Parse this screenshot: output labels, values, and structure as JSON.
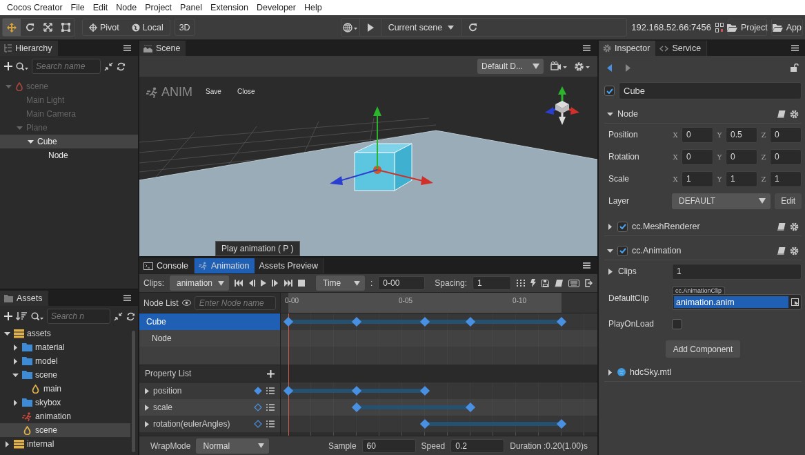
{
  "menu": [
    "Cocos Creator",
    "File",
    "Edit",
    "Node",
    "Project",
    "Panel",
    "Extension",
    "Developer",
    "Help"
  ],
  "toolbar": {
    "tools": [
      {
        "kind": "move",
        "selected": true
      },
      {
        "kind": "rotate",
        "selected": false
      },
      {
        "kind": "scale",
        "selected": false
      },
      {
        "kind": "rect",
        "selected": false
      }
    ],
    "pivot": "Pivot",
    "local": "Local",
    "view_mode": "3D",
    "scene": "Current scene",
    "address": "192.168.52.66:7456",
    "project": "Project",
    "app": "App"
  },
  "hierarchy": {
    "title": "Hierarchy",
    "search_placeholder": "Search name",
    "tree": [
      {
        "name": "scene",
        "kind": "scene",
        "disabled": true,
        "expanded": true,
        "selected": false,
        "children": [
          {
            "name": "Main Light",
            "disabled": true,
            "selected": false
          },
          {
            "name": "Main Camera",
            "disabled": true,
            "selected": false
          },
          {
            "name": "Plane",
            "disabled": true,
            "expanded": true,
            "selected": false,
            "children": [
              {
                "name": "Cube",
                "disabled": false,
                "expanded": true,
                "selected": true,
                "children": [
                  {
                    "name": "Node",
                    "disabled": false,
                    "selected": false
                  }
                ]
              }
            ]
          }
        ]
      }
    ]
  },
  "assets": {
    "title": "Assets",
    "search_placeholder": "Search n",
    "tree": [
      {
        "name": "assets",
        "kind": "database",
        "expanded": true,
        "selected": false,
        "children": [
          {
            "name": "material",
            "kind": "folder",
            "expanded": false,
            "selected": false
          },
          {
            "name": "model",
            "kind": "folder",
            "expanded": false,
            "selected": false
          },
          {
            "name": "scene",
            "kind": "folder",
            "expanded": true,
            "selected": false,
            "children": [
              {
                "name": "main",
                "kind": "scene",
                "selected": false
              }
            ]
          },
          {
            "name": "skybox",
            "kind": "folder",
            "expanded": false,
            "selected": false
          },
          {
            "name": "animation",
            "kind": "animation",
            "selected": false
          },
          {
            "name": "scene",
            "kind": "scene",
            "selected": true
          }
        ]
      },
      {
        "name": "internal",
        "kind": "database",
        "expanded": false,
        "selected": false
      }
    ]
  },
  "scene": {
    "title": "Scene",
    "layout": "Default D...",
    "overlay_title": "ANIM",
    "save": "Save",
    "close": "Close"
  },
  "animation": {
    "tabs": [
      {
        "label": "Console",
        "kind": "console",
        "selected": false
      },
      {
        "label": "Animation",
        "kind": "animation",
        "selected": true
      },
      {
        "label": "Assets Preview",
        "kind": "preview",
        "selected": false
      }
    ],
    "tooltip": "Play animation ( P )",
    "clips_label": "Clips:",
    "clip": "animation",
    "time_mode": "Time",
    "time_separator": ":",
    "time_value": "0-00",
    "spacing_label": "Spacing:",
    "spacing": "1",
    "node_list_label": "Node List",
    "node_search_placeholder": "Enter Node name",
    "ruler": [
      "0-00",
      "0-05",
      "0-10"
    ],
    "nodes": [
      {
        "name": "Cube",
        "selected": true,
        "frames": [
          {
            "keyed": true
          },
          {
            "keyed": false
          },
          {
            "keyed": false
          },
          {
            "keyed": true
          },
          {
            "keyed": false
          },
          {
            "keyed": false
          },
          {
            "keyed": true
          },
          {
            "keyed": false
          },
          {
            "keyed": true
          },
          {
            "keyed": false
          },
          {
            "keyed": false
          },
          {
            "keyed": false
          },
          {
            "keyed": true
          }
        ]
      },
      {
        "name": "Node",
        "selected": false
      }
    ],
    "property_list_label": "Property List",
    "properties": [
      {
        "name": "position",
        "keyed": true,
        "frames": [
          {
            "keyed": true
          },
          {
            "keyed": false
          },
          {
            "keyed": false
          },
          {
            "keyed": true
          },
          {
            "keyed": false
          },
          {
            "keyed": false
          },
          {
            "keyed": true
          }
        ]
      },
      {
        "name": "scale",
        "keyed": false,
        "frames": [
          {
            "keyed": false
          },
          {
            "keyed": false
          },
          {
            "keyed": false
          },
          {
            "keyed": true
          },
          {
            "keyed": false
          },
          {
            "keyed": false
          },
          {
            "keyed": false
          },
          {
            "keyed": false
          },
          {
            "keyed": true
          }
        ]
      },
      {
        "name": "rotation(eulerAngles)",
        "keyed": false,
        "frames": [
          {
            "keyed": false
          },
          {
            "keyed": false
          },
          {
            "keyed": false
          },
          {
            "keyed": false
          },
          {
            "keyed": false
          },
          {
            "keyed": false
          },
          {
            "keyed": true
          },
          {
            "keyed": false
          },
          {
            "keyed": false
          },
          {
            "keyed": false
          },
          {
            "keyed": false
          },
          {
            "keyed": false
          },
          {
            "keyed": true
          }
        ]
      }
    ],
    "wrap_mode_label": "WrapMode",
    "wrap_mode": "Normal",
    "sample_label": "Sample",
    "sample": "60",
    "speed_label": "Speed",
    "speed": "0.2",
    "duration": "Duration :0.20(1.00)s"
  },
  "inspector": {
    "tabs": [
      {
        "label": "Inspector",
        "kind": "gear",
        "selected": true
      },
      {
        "label": "Service",
        "kind": "link",
        "selected": false
      }
    ],
    "node_name": "Cube",
    "active": true,
    "node_section": {
      "title": "Node",
      "expanded": true,
      "vectors": [
        {
          "label": "Position",
          "values": [
            {
              "axis": "X",
              "value": "0"
            },
            {
              "axis": "Y",
              "value": "0.5"
            },
            {
              "axis": "Z",
              "value": "0"
            }
          ]
        },
        {
          "label": "Rotation",
          "values": [
            {
              "axis": "X",
              "value": "0"
            },
            {
              "axis": "Y",
              "value": "0"
            },
            {
              "axis": "Z",
              "value": "0"
            }
          ]
        },
        {
          "label": "Scale",
          "values": [
            {
              "axis": "X",
              "value": "1"
            },
            {
              "axis": "Y",
              "value": "1"
            },
            {
              "axis": "Z",
              "value": "1"
            }
          ]
        }
      ],
      "layer_label": "Layer",
      "layer": "DEFAULT",
      "edit": "Edit"
    },
    "components": [
      {
        "name": "cc.MeshRenderer",
        "enabled": true,
        "expanded": false
      },
      {
        "name": "cc.Animation",
        "enabled": true,
        "expanded": true,
        "properties": [
          {
            "kind": "array",
            "label": "Clips",
            "value": "1",
            "expanded": false
          },
          {
            "kind": "asset",
            "label": "DefaultClip",
            "type": "cc.AnimationClip",
            "value": "animation.anim"
          },
          {
            "kind": "checkbox",
            "label": "PlayOnLoad",
            "checked": false
          }
        ]
      }
    ],
    "add_component": "Add Component",
    "material": {
      "name": "hdcSky.mtl",
      "expanded": false
    }
  }
}
